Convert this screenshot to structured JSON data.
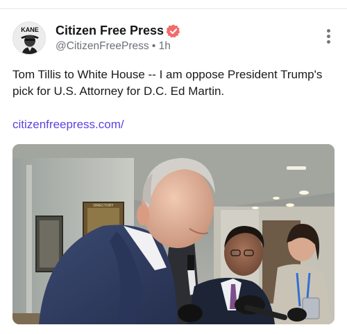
{
  "post": {
    "author": {
      "name": "Citizen Free Press",
      "handle": "@CitizenFreePress",
      "time": "1h",
      "separator": "•",
      "verified": true,
      "verified_color": "#f26b6b",
      "avatar_text": "KANE"
    },
    "text": "Tom Tillis to White House -- I am oppose President Trump's pick for U.S. Attorney for D.C. Ed Martin.",
    "link": "citizenfreepress.com/",
    "link_color": "#5a44e0",
    "menu_icon": "more-vertical-icon",
    "media": {
      "type": "photo",
      "sign_text": "DIRECTORY"
    }
  }
}
